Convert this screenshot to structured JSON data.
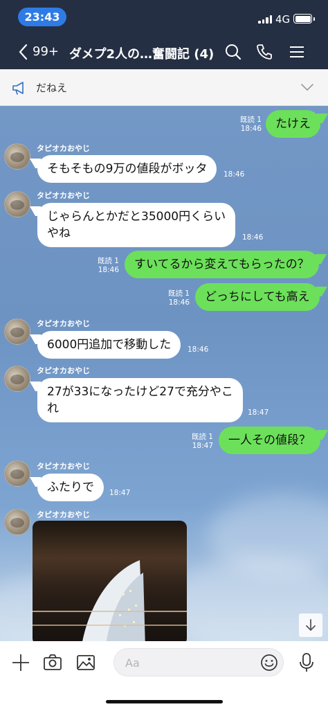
{
  "status_bar": {
    "time": "23:43",
    "network": "4G"
  },
  "header": {
    "back_count": "99+",
    "title": "ダメプ2人の…奮闘記 (4)"
  },
  "announcement": {
    "text": "だねえ"
  },
  "chat": {
    "sender_name": "タピオカおやじ",
    "messages": [
      {
        "side": "out",
        "text": "たけえ",
        "read": "既読 1",
        "time": "18:46"
      },
      {
        "side": "in",
        "text": "そもそもの9万の値段がボッタ",
        "time": "18:46"
      },
      {
        "side": "in",
        "line1": "じゃらんとかだと35000円くらい",
        "line2": "やね",
        "time": "18:46"
      },
      {
        "side": "out",
        "text": "すいてるから変えてもらったの？",
        "read": "既読 1",
        "time": "18:46"
      },
      {
        "side": "out",
        "text": "どっちにしても高え",
        "read": "既読 1",
        "time": "18:46"
      },
      {
        "side": "in",
        "text": "6000円追加で移動した",
        "time": "18:46"
      },
      {
        "side": "in",
        "line1": "27が33になったけど27で充分やこ",
        "line2": "れ",
        "time": "18:47"
      },
      {
        "side": "out",
        "text": "一人その値段？",
        "read": "既読 1",
        "time": "18:47"
      },
      {
        "side": "in",
        "text": "ふたりで",
        "time": "18:47"
      }
    ]
  },
  "input": {
    "placeholder": "Aa"
  },
  "icons": {
    "back": "chevron-left-icon",
    "search": "search-icon",
    "call": "phone-icon",
    "menu": "hamburger-menu-icon",
    "announce": "megaphone-icon",
    "expand": "chevron-down-icon",
    "scroll": "arrow-down-icon",
    "plus": "plus-icon",
    "camera": "camera-icon",
    "image": "image-icon",
    "emoji": "emoji-icon",
    "mic": "microphone-icon"
  },
  "colors": {
    "header_bg": "#252f43",
    "chat_bg": "#7398c6",
    "out_bubble": "#6ce05a",
    "in_bubble": "#ffffff",
    "time_pill": "#2f7be6"
  }
}
